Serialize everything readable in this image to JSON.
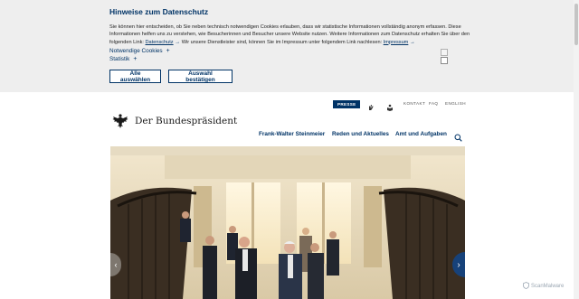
{
  "cookie": {
    "title": "Hinweise zum Datenschutz",
    "text_1": "Sie können hier entscheiden, ob Sie neben technisch notwendigen Cookies erlauben, dass wir statistische Informationen vollständig anonym erfassen. Diese Informationen helfen uns zu verstehen, wie Besucherinnen und Besucher unsere Website nutzen. Weitere Informationen zum Datenschutz erhalten Sie über den folgenden Link:",
    "link_datenschutz": "Datenschutz",
    "text_2": "Wir unsere Dienstleister sind, können Sie im Impressum unter folgendem Link nachlesen:",
    "link_impressum": "Impressum",
    "option_1": "Notwendige Cookies",
    "option_2": "Statistik",
    "btn_all": "Alle auswählen",
    "btn_confirm": "Auswahl bestätigen"
  },
  "header": {
    "presse": "PRESSE",
    "kontakt": "KONTAKT",
    "faq": "FAQ",
    "english": "ENGLISH",
    "site_name": "Der Bundespräsident"
  },
  "nav": {
    "item_1": "Frank-Walter Steinmeier",
    "item_2": "Reden und Aktuelles",
    "item_3": "Amt und Aufgaben"
  },
  "watermark": "ScanMalware",
  "colors": {
    "brand": "#003366",
    "banner_bg": "#eeeeee",
    "pager": "#17427a"
  }
}
